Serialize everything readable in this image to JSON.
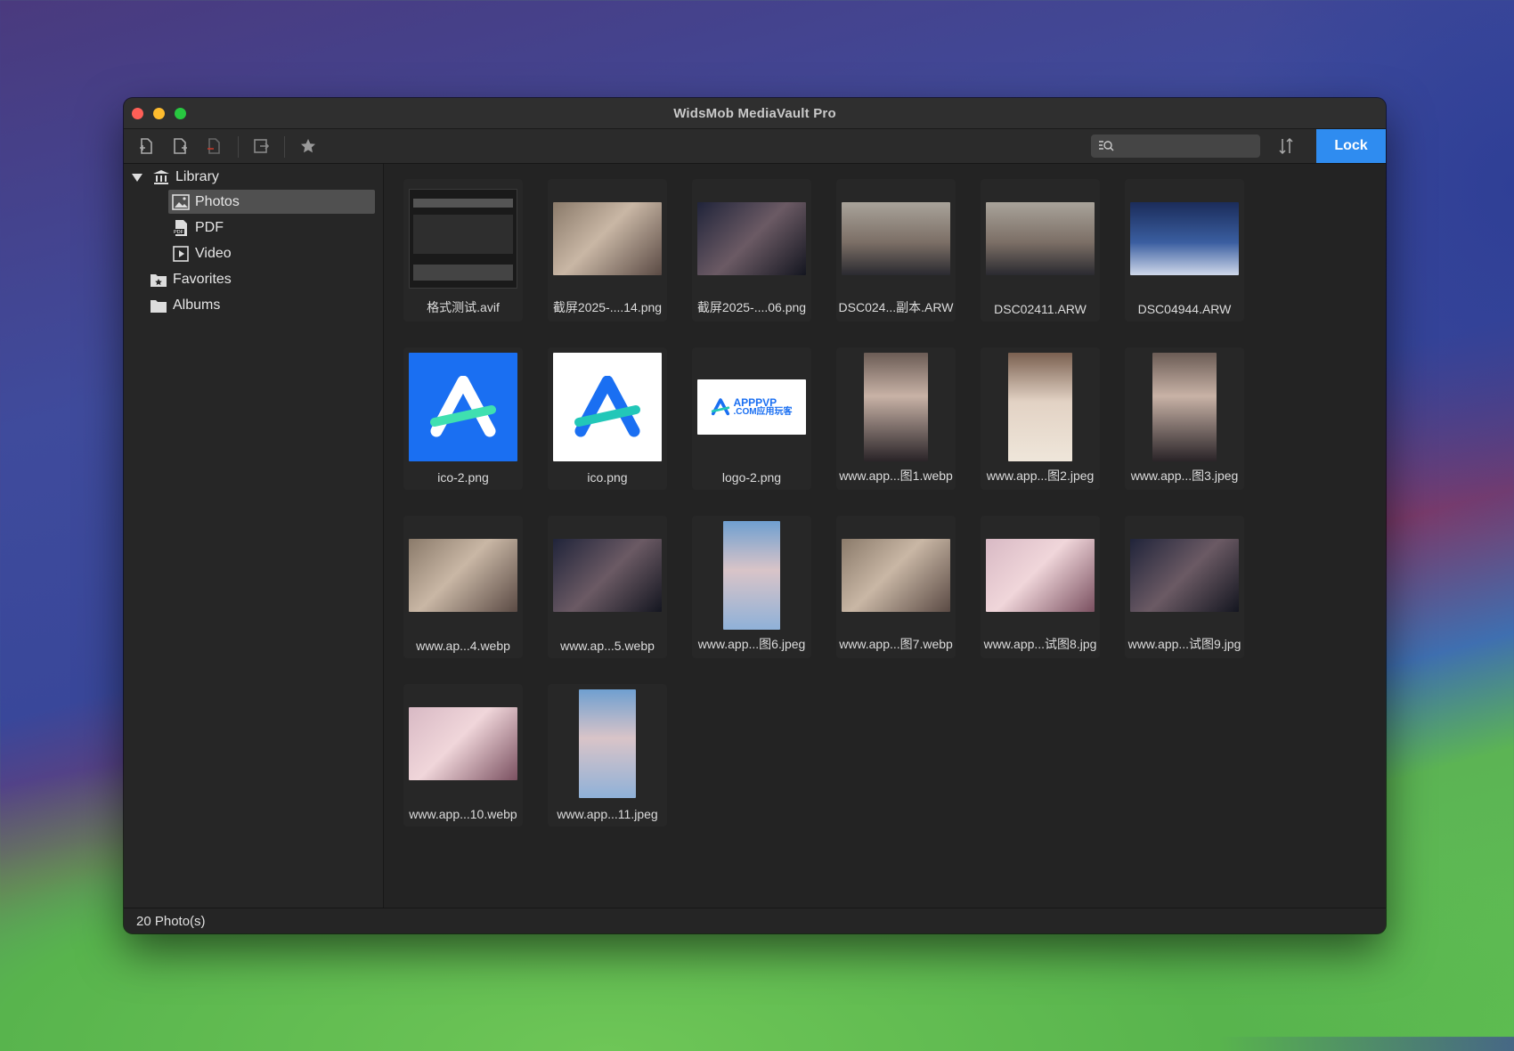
{
  "window": {
    "title": "WidsMob MediaVault Pro"
  },
  "toolbar": {
    "buttons": [
      "add-file-icon",
      "add-folder-icon",
      "remove-file-icon",
      "export-icon",
      "favorite-star-icon"
    ],
    "search_placeholder": "",
    "lock_label": "Lock"
  },
  "sidebar": {
    "library_label": "Library",
    "photos_label": "Photos",
    "pdf_label": "PDF",
    "video_label": "Video",
    "favorites_label": "Favorites",
    "albums_label": "Albums",
    "pdf_badge": "PDF"
  },
  "grid": {
    "items": [
      {
        "name": "格式测试.avif",
        "kind": "screenshot-dark"
      },
      {
        "name": "截屏2025-....14.png",
        "kind": "portrait-wide"
      },
      {
        "name": "截屏2025-....06.png",
        "kind": "portrait-wide-dark"
      },
      {
        "name": "DSC024...副本.ARW",
        "kind": "group-photo"
      },
      {
        "name": "DSC02411.ARW",
        "kind": "group-photo"
      },
      {
        "name": "DSC04944.ARW",
        "kind": "wedding-blue"
      },
      {
        "name": "ico-2.png",
        "kind": "logo-blue-bg"
      },
      {
        "name": "ico.png",
        "kind": "logo-white-bg"
      },
      {
        "name": "logo-2.png",
        "kind": "wordmark"
      },
      {
        "name": "www.app...图1.webp",
        "kind": "portrait-tall"
      },
      {
        "name": "www.app...图2.jpeg",
        "kind": "portrait-tall-light"
      },
      {
        "name": "www.app...图3.jpeg",
        "kind": "portrait-tall"
      },
      {
        "name": "www.ap...4.webp",
        "kind": "portrait-wide"
      },
      {
        "name": "www.ap...5.webp",
        "kind": "portrait-wide-dark"
      },
      {
        "name": "www.app...图6.jpeg",
        "kind": "portrait-tall-sky"
      },
      {
        "name": "www.app...图7.webp",
        "kind": "portrait-wide"
      },
      {
        "name": "www.app...试图8.jpg",
        "kind": "portrait-wide-pink"
      },
      {
        "name": "www.app...试图9.jpg",
        "kind": "portrait-wide-dark"
      },
      {
        "name": "www.app...10.webp",
        "kind": "portrait-wide-pink"
      },
      {
        "name": "www.app...11.jpeg",
        "kind": "portrait-tall-sky"
      }
    ],
    "wordmark_top": "APPPVP",
    "wordmark_bottom": ".COM应用玩客"
  },
  "status": {
    "count_text": "20 Photo(s)"
  },
  "colors": {
    "accent": "#2f8cf0",
    "window_bg": "#242424",
    "selected_row": "#505050"
  }
}
